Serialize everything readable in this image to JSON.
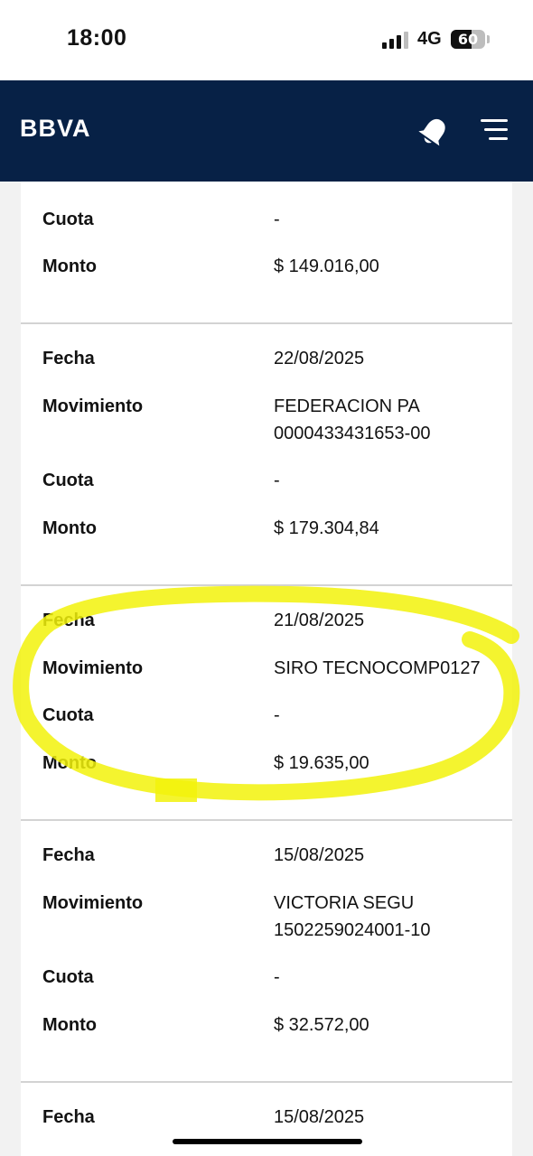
{
  "status_bar": {
    "time": "18:00",
    "network": "4G",
    "battery_level": "60",
    "battery_percent": 60
  },
  "header": {
    "logo": "BBVA",
    "bell_icon": "bell-icon",
    "menu_icon": "hamburger-menu-icon",
    "background_color": "#072146"
  },
  "movements": [
    {
      "rows": [
        {
          "label": "Cuota",
          "value": "-"
        },
        {
          "label": "Monto",
          "value": "$ 149.016,00"
        }
      ]
    },
    {
      "rows": [
        {
          "label": "Fecha",
          "value": "22/08/2025"
        },
        {
          "label": "Movimiento",
          "value": "FEDERACION PA\n0000433431653-00"
        },
        {
          "label": "Cuota",
          "value": "-"
        },
        {
          "label": "Monto",
          "value": "$ 179.304,84"
        }
      ]
    },
    {
      "rows": [
        {
          "label": "Fecha",
          "value": "21/08/2025"
        },
        {
          "label": "Movimiento",
          "value": "SIRO TECNOCOMP0127"
        },
        {
          "label": "Cuota",
          "value": "-"
        },
        {
          "label": "Monto",
          "value": "$ 19.635,00"
        }
      ]
    },
    {
      "rows": [
        {
          "label": "Fecha",
          "value": "15/08/2025"
        },
        {
          "label": "Movimiento",
          "value": "VICTORIA SEGU\n1502259024001-10"
        },
        {
          "label": "Cuota",
          "value": "-"
        },
        {
          "label": "Monto",
          "value": "$ 32.572,00"
        }
      ]
    },
    {
      "rows": [
        {
          "label": "Fecha",
          "value": "15/08/2025"
        }
      ]
    }
  ],
  "annotation": {
    "color": "#f2f20a"
  }
}
